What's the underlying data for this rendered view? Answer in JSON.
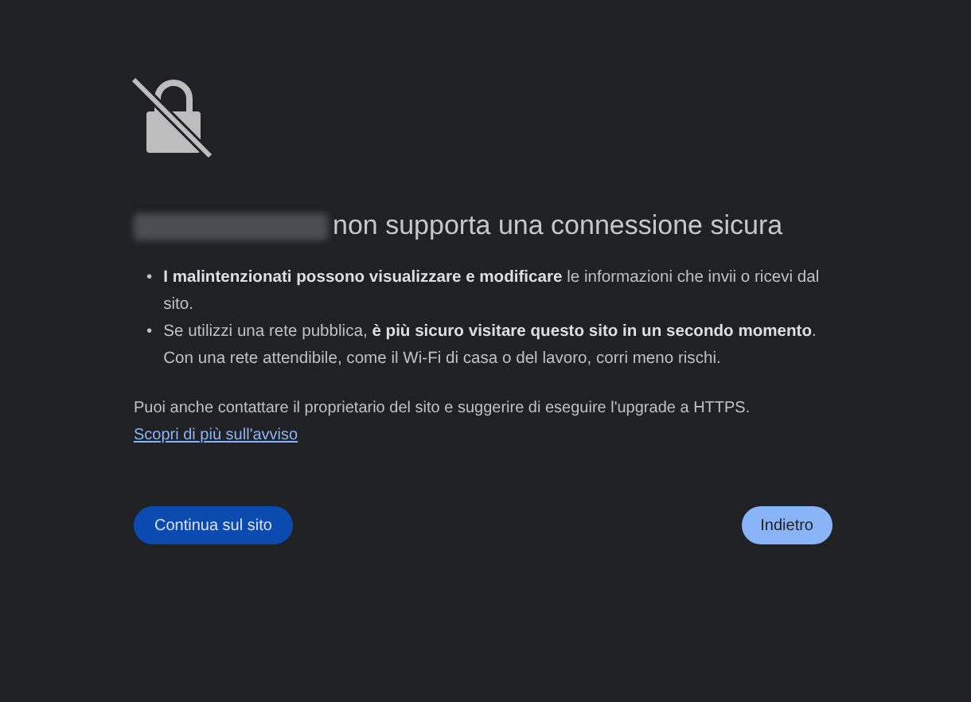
{
  "heading": "non supporta una connessione sicura",
  "bullets": [
    {
      "marker": "•",
      "text": "**I malintenzionati possono visualizzare e modificare** le informazioni che invii o ricevi dal sito."
    },
    {
      "marker": "•",
      "text": "Se utilizzi una rete pubblica, **è più sicuro visitare questo sito in un secondo momento**. Con una rete attendibile, come il Wi-Fi di casa o del lavoro, corri meno rischi."
    }
  ],
  "note": "Puoi anche contattare il proprietario del sito e suggerire di eseguire l'upgrade a HTTPS.",
  "link": "Scopri di più sull'avviso",
  "buttons": [
    {
      "label": "Continua sul sito",
      "kind": "primary"
    },
    {
      "label": "Indietro",
      "kind": "secondary"
    }
  ]
}
